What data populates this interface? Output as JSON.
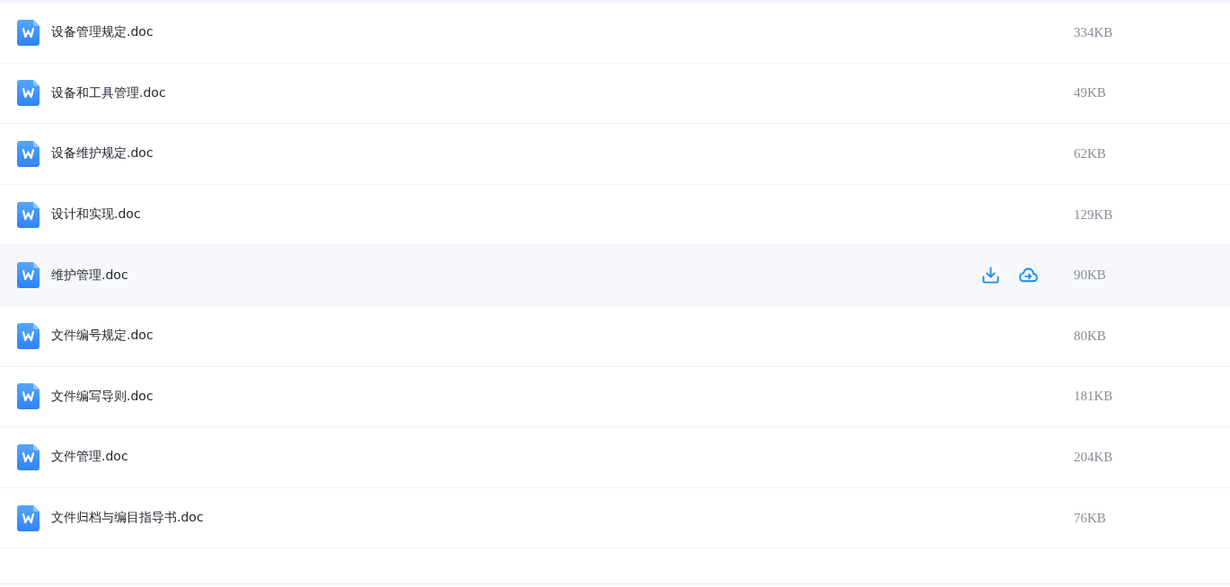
{
  "files": [
    {
      "name": "设备管理规定.doc",
      "size": "334KB",
      "hovered": false
    },
    {
      "name": "设备和工具管理.doc",
      "size": "49KB",
      "hovered": false
    },
    {
      "name": "设备维护规定.doc",
      "size": "62KB",
      "hovered": false
    },
    {
      "name": "设计和实现.doc",
      "size": "129KB",
      "hovered": false
    },
    {
      "name": "维护管理.doc",
      "size": "90KB",
      "hovered": true
    },
    {
      "name": "文件编号规定.doc",
      "size": "80KB",
      "hovered": false
    },
    {
      "name": "文件编写导则.doc",
      "size": "181KB",
      "hovered": false
    },
    {
      "name": "文件管理.doc",
      "size": "204KB",
      "hovered": false
    },
    {
      "name": "文件归档与编目指导书.doc",
      "size": "76KB",
      "hovered": false
    }
  ]
}
